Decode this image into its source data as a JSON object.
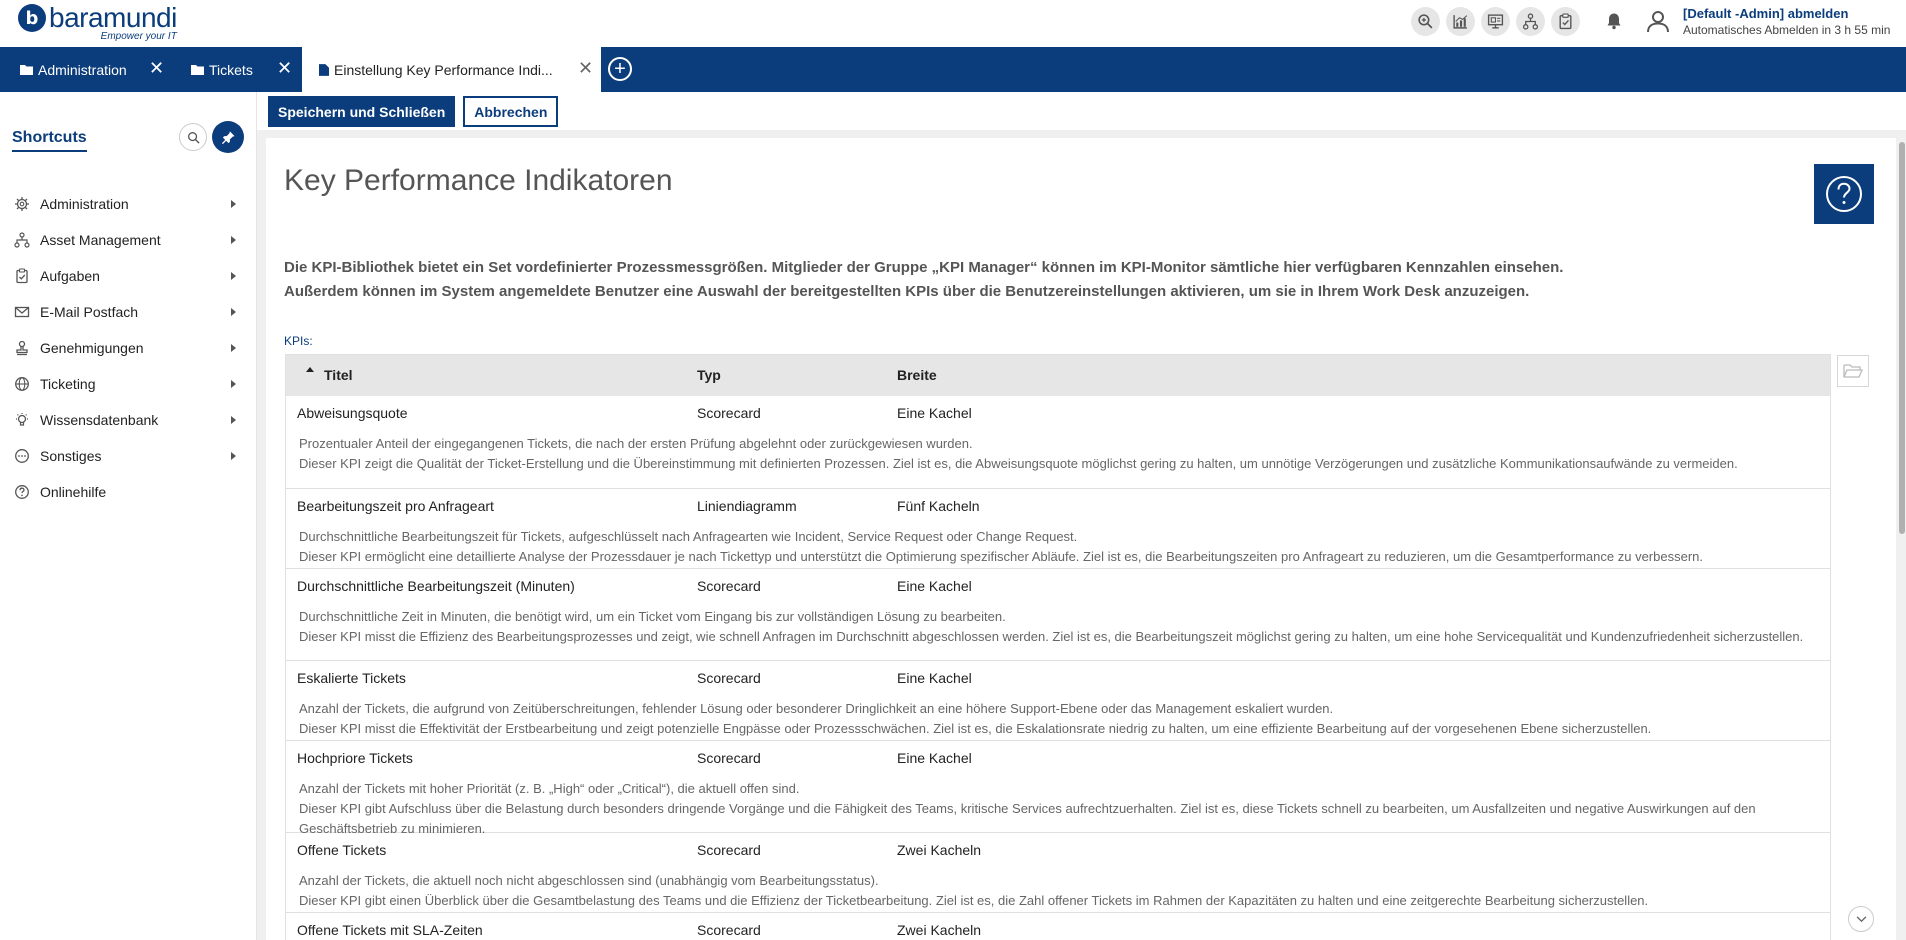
{
  "app": {
    "logo_mark": "b",
    "logo_text": "baramundi",
    "logo_tagline": "Empower your IT"
  },
  "header": {
    "icons": [
      "zoom-icon",
      "chart-icon",
      "presentation-icon",
      "hierarchy-icon",
      "clipboard-icon"
    ],
    "user_name": "[Default -Admin]  abmelden",
    "logout_info": "Automatisches Abmelden in 3 h 55 min"
  },
  "tabs": [
    {
      "label": "Administration",
      "active": false
    },
    {
      "label": "Tickets",
      "active": false
    },
    {
      "label": "Einstellung Key Performance Indi...",
      "active": true
    }
  ],
  "sidebar": {
    "title": "Shortcuts",
    "items": [
      {
        "label": "Administration",
        "icon": "gear-icon",
        "has_children": true
      },
      {
        "label": "Asset Management",
        "icon": "hierarchy-icon",
        "has_children": true
      },
      {
        "label": "Aufgaben",
        "icon": "clipboard-icon",
        "has_children": true
      },
      {
        "label": "E-Mail Postfach",
        "icon": "mail-icon",
        "has_children": true
      },
      {
        "label": "Genehmigungen",
        "icon": "stamp-icon",
        "has_children": true
      },
      {
        "label": "Ticketing",
        "icon": "globe-icon",
        "has_children": true
      },
      {
        "label": "Wissensdatenbank",
        "icon": "bulb-icon",
        "has_children": true
      },
      {
        "label": "Sonstiges",
        "icon": "more-icon",
        "has_children": true
      },
      {
        "label": "Onlinehilfe",
        "icon": "help-icon",
        "has_children": false
      }
    ]
  },
  "toolbar": {
    "save_label": "Speichern und Schließen",
    "cancel_label": "Abbrechen"
  },
  "page": {
    "title": "Key Performance Indikatoren",
    "intro_line1": "Die KPI-Bibliothek bietet ein Set vordefinierter Prozessmessgrößen. Mitglieder der Gruppe „KPI Manager“ können im KPI-Monitor sämtliche hier verfügbaren Kennzahlen einsehen.",
    "intro_line2": "Außerdem können im System angemeldete Benutzer eine Auswahl der bereitgestellten KPIs über die Benutzereinstellungen aktivieren, um sie in Ihrem Work Desk anzuzeigen.",
    "kpis_label": "KPIs:"
  },
  "table": {
    "columns": {
      "title": "Titel",
      "type": "Typ",
      "width": "Breite"
    },
    "rows": [
      {
        "title": "Abweisungsquote",
        "type": "Scorecard",
        "width": "Eine Kachel",
        "desc1": "Prozentualer Anteil der eingegangenen Tickets, die nach der ersten Prüfung abgelehnt oder zurückgewiesen wurden.",
        "desc2": "Dieser KPI zeigt die Qualität der Ticket-Erstellung und die Übereinstimmung mit definierten Prozessen. Ziel ist es, die Abweisungsquote möglichst gering zu halten, um unnötige Verzögerungen und zusätzliche Kommunikationsaufwände zu vermeiden."
      },
      {
        "title": "Bearbeitungszeit pro Anfrageart",
        "type": "Liniendiagramm",
        "width": "Fünf Kacheln",
        "desc1": "Durchschnittliche Bearbeitungszeit für Tickets, aufgeschlüsselt nach Anfragearten wie Incident, Service Request oder Change Request.",
        "desc2": "Dieser KPI ermöglicht eine detaillierte Analyse der Prozessdauer je nach Tickettyp und unterstützt die Optimierung spezifischer Abläufe. Ziel ist es, die Bearbeitungszeiten pro Anfrageart zu reduzieren, um die Gesamtperformance zu verbessern."
      },
      {
        "title": "Durchschnittliche Bearbeitungszeit (Minuten)",
        "type": "Scorecard",
        "width": "Eine Kachel",
        "desc1": "Durchschnittliche Zeit in Minuten, die benötigt wird, um ein Ticket vom Eingang bis zur vollständigen Lösung zu bearbeiten.",
        "desc2": "Dieser KPI misst die Effizienz des Bearbeitungsprozesses und zeigt, wie schnell Anfragen im Durchschnitt abgeschlossen werden. Ziel ist es, die Bearbeitungszeit möglichst gering zu halten, um eine hohe Servicequalität und Kundenzufriedenheit sicherzustellen."
      },
      {
        "title": "Eskalierte Tickets",
        "type": "Scorecard",
        "width": "Eine Kachel",
        "desc1": "Anzahl der Tickets, die aufgrund von Zeitüberschreitungen, fehlender Lösung oder besonderer Dringlichkeit an eine höhere Support-Ebene oder das Management eskaliert wurden.",
        "desc2": "Dieser KPI misst die Effektivität der Erstbearbeitung und zeigt potenzielle Engpässe oder Prozessschwächen. Ziel ist es, die Eskalationsrate niedrig zu halten, um eine effiziente Bearbeitung auf der vorgesehenen Ebene sicherzustellen."
      },
      {
        "title": "Hochpriore Tickets",
        "type": "Scorecard",
        "width": "Eine Kachel",
        "desc1": "Anzahl der Tickets mit hoher Priorität (z. B. „High“ oder „Critical“), die aktuell offen sind.",
        "desc2": "Dieser KPI gibt Aufschluss über die Belastung durch besonders dringende Vorgänge und die Fähigkeit des Teams, kritische Services aufrechtzuerhalten. Ziel ist es, diese Tickets schnell zu bearbeiten, um Ausfallzeiten und negative Auswirkungen auf den Geschäftsbetrieb zu minimieren."
      },
      {
        "title": "Offene Tickets",
        "type": "Scorecard",
        "width": "Zwei Kacheln",
        "desc1": "Anzahl der Tickets, die aktuell noch nicht abgeschlossen sind (unabhängig vom Bearbeitungsstatus).",
        "desc2": "Dieser KPI gibt einen Überblick über die Gesamtbelastung des Teams und die Effizienz der Ticketbearbeitung. Ziel ist es, die Zahl offener Tickets im Rahmen der Kapazitäten zu halten und eine zeitgerechte Bearbeitung sicherzustellen."
      },
      {
        "title": "Offene Tickets mit SLA-Zeiten",
        "type": "Scorecard",
        "width": "Zwei Kacheln",
        "desc1": "",
        "desc2": ""
      }
    ]
  },
  "colors": {
    "brand": "#0b3d7c",
    "header_bg": "#ffffff",
    "table_header_bg": "#e6e6e6"
  }
}
